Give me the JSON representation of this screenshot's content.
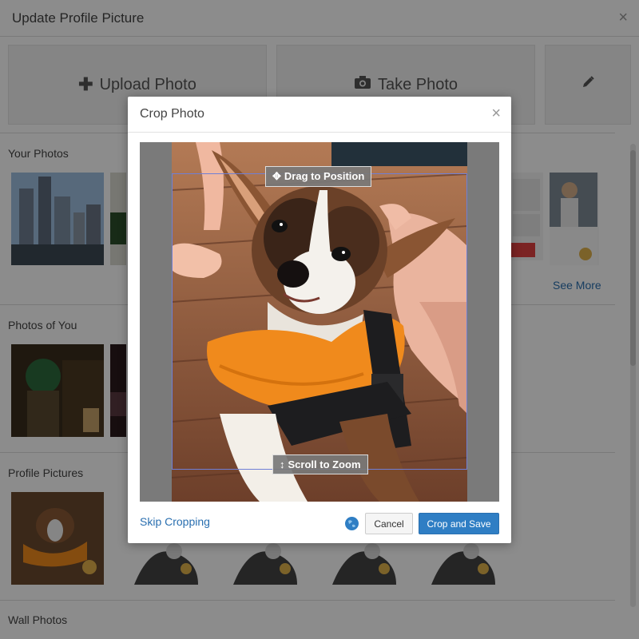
{
  "background_dialog": {
    "title": "Update Profile Picture",
    "close_glyph": "×",
    "actions": [
      {
        "label": "Upload Photo",
        "icon": "plus-icon"
      },
      {
        "label": "Take Photo",
        "icon": "camera-icon"
      },
      {
        "label": "",
        "icon": "pencil-icon"
      }
    ],
    "sections": {
      "your_photos": "Your Photos",
      "photos_of_you": "Photos of You",
      "profile_pictures": "Profile Pictures",
      "wall_photos": "Wall Photos"
    },
    "see_more": "See More"
  },
  "crop_modal": {
    "title": "Crop Photo",
    "close_glyph": "×",
    "drag_label": "Drag to Position",
    "zoom_label": "Scroll to Zoom",
    "skip_link": "Skip Cropping",
    "cancel_button": "Cancel",
    "save_button": "Crop and Save"
  },
  "colors": {
    "accent_blue": "#2f7ec4",
    "link_blue": "#2a6fb0",
    "crop_frame": "#6f7fd6",
    "life_vest_orange": "#f08a1c"
  }
}
